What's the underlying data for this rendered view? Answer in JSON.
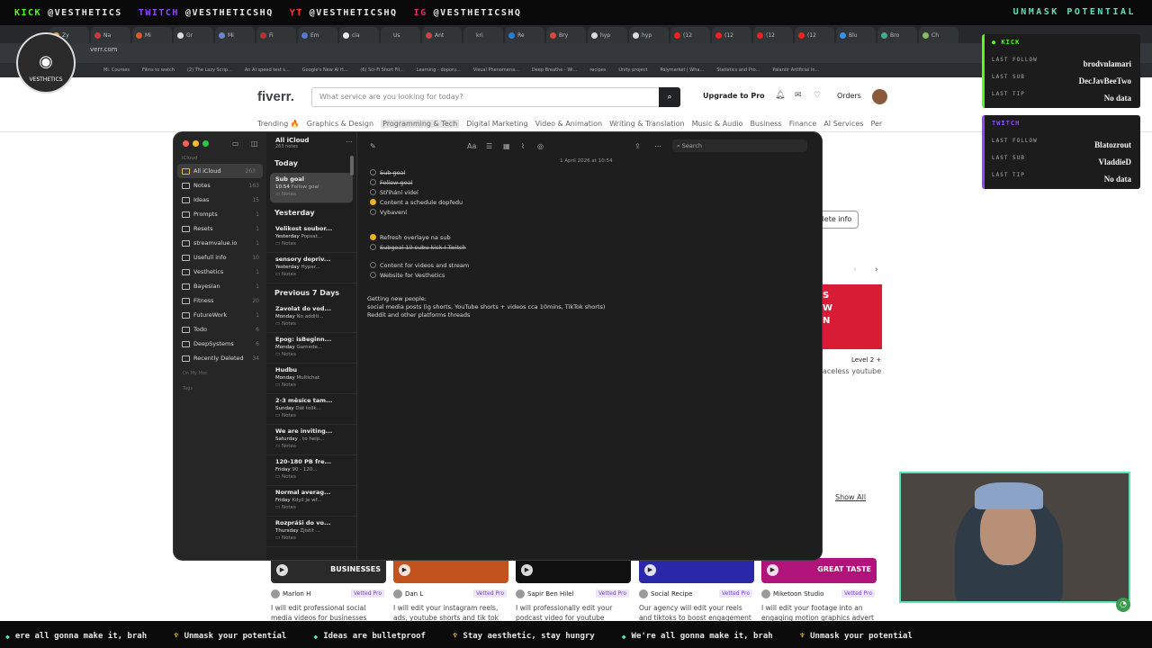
{
  "overlay_top": {
    "socials": [
      {
        "platform": "KICK",
        "handle": "@VESTHETICS",
        "color": "#53fc18"
      },
      {
        "platform": "TWITCH",
        "handle": "@VESTHETICSHQ",
        "color": "#9146ff"
      },
      {
        "platform": "YT",
        "handle": "@VESTHETICSHQ",
        "color": "#ff3b3b"
      },
      {
        "platform": "IG",
        "handle": "@VESTHETICSHQ",
        "color": "#e1306c"
      }
    ],
    "slogan": "UNMASK POTENTIAL"
  },
  "browser": {
    "tabs": [
      "Zy",
      "Na",
      "Mi",
      "Gr",
      "Mi",
      "Fi",
      "Em",
      "cla",
      "Us",
      "Ant",
      "kri",
      "Re",
      "Bry",
      "hyp",
      "hyp",
      "(12",
      "(12",
      "(12",
      "(12",
      "Blu",
      "Bro",
      "Ch"
    ],
    "url": "verr.com",
    "bookmarks": [
      "Mi. Courses",
      "Films to watch",
      "(2) The Lazy Scrip...",
      "An AI speed test s...",
      "Google's New AI H...",
      "(6) Sci-Fi Short Fil...",
      "Learning - doporu...",
      "Visual Phenomena...",
      "Deep Breathe - Wi...",
      "recipes",
      "Unity project",
      "Polymarket | Wha...",
      "Statistics and Pro...",
      "Palantir Artificial In..."
    ]
  },
  "fiverr": {
    "logo": "fiverr.",
    "search_placeholder": "What service are you looking for today?",
    "upgrade": "Upgrade to Pro",
    "orders": "Orders",
    "categories": [
      "Trending 🔥",
      "Graphics & Design",
      "Programming & Tech",
      "Digital Marketing",
      "Video & Animation",
      "Writing & Translation",
      "Music & Audio",
      "Business",
      "Finance",
      "AI Services",
      "Per"
    ],
    "delete_info": "elete info",
    "promo_text": "S\nW\nN",
    "level": "Level 2 +",
    "faceless": "aceless youtube",
    "show_all": "Show All",
    "gigs": [
      {
        "seller": "Marlon H",
        "badge": "Vetted Pro",
        "desc": "I will edit professional social media videos for businesses",
        "thumb": "#2a2a2a",
        "thumb_text": "BUSINESSES"
      },
      {
        "seller": "Dan L",
        "badge": "Vetted Pro",
        "desc": "I will edit your instagram reels, ads, youtube shorts and tik tok",
        "thumb": "#c2521e",
        "thumb_text": ""
      },
      {
        "seller": "Sapir Ben Hilel",
        "badge": "Vetted Pro",
        "desc": "I will professionally edit your podcast video for youtube",
        "thumb": "#111111",
        "thumb_text": ""
      },
      {
        "seller": "Social Recipe",
        "badge": "Vetted Pro",
        "desc": "Our agency will edit your reels and tiktoks to boost engagement",
        "thumb": "#2a27a8",
        "thumb_text": ""
      },
      {
        "seller": "Miketoon Studio",
        "badge": "Vetted Pro",
        "desc": "I will edit your footage into an engaging motion graphics advert",
        "thumb": "#b0147a",
        "thumb_text": "GREAT TASTE"
      }
    ]
  },
  "notes_app": {
    "header_title": "All iCloud",
    "header_count": "263 notes",
    "search_placeholder": "Search",
    "sidebar_section": "iCloud",
    "folders": [
      {
        "name": "All iCloud",
        "count": "263"
      },
      {
        "name": "Notes",
        "count": "163"
      },
      {
        "name": "Ideas",
        "count": "15"
      },
      {
        "name": "Prompts",
        "count": "1"
      },
      {
        "name": "Resets",
        "count": "1"
      },
      {
        "name": "streamvalue.io",
        "count": "1"
      },
      {
        "name": "Usefull info",
        "count": "10"
      },
      {
        "name": "Vesthetics",
        "count": "1"
      },
      {
        "name": "Bayesian",
        "count": "1"
      },
      {
        "name": "Fitness",
        "count": "20"
      },
      {
        "name": "FutureWork",
        "count": "1"
      },
      {
        "name": "Todo",
        "count": "6"
      },
      {
        "name": "DeepSystems",
        "count": "6"
      },
      {
        "name": "Recently Deleted",
        "count": "34"
      }
    ],
    "sidebar_footer": [
      "On My Mac",
      "Tags"
    ],
    "sections": {
      "today": "Today",
      "yesterday": "Yesterday",
      "prev7": "Previous 7 Days"
    },
    "notes": [
      {
        "section": "today",
        "title": "Sub goal",
        "time": "10:54",
        "snippet": "Follow goal",
        "folder": "Notes"
      },
      {
        "section": "yesterday",
        "title": "Velikost soubor...",
        "time": "Yesterday",
        "snippet": "Popsat...",
        "folder": "Notes"
      },
      {
        "section": "yesterday",
        "title": "sensory depriv...",
        "time": "Yesterday",
        "snippet": "Hyper...",
        "folder": "Notes"
      },
      {
        "section": "prev7",
        "title": "Zavolat do vod...",
        "time": "Monday",
        "snippet": "No additi...",
        "folder": "Notes"
      },
      {
        "section": "prev7",
        "title": "Epog: isBeginn...",
        "time": "Monday",
        "snippet": "Gamede...",
        "folder": "Notes"
      },
      {
        "section": "prev7",
        "title": "Hudbu",
        "time": "Monday",
        "snippet": "Multichat",
        "folder": "Notes"
      },
      {
        "section": "prev7",
        "title": "2-3 měsíce tam...",
        "time": "Sunday",
        "snippet": "Dát tolik...",
        "folder": "Notes"
      },
      {
        "section": "prev7",
        "title": "We are inviting...",
        "time": "Saturday",
        "snippet": ", to help...",
        "folder": "Notes"
      },
      {
        "section": "prev7",
        "title": "120-180 PB fre...",
        "time": "Friday",
        "snippet": "90 - 120...",
        "folder": "Notes"
      },
      {
        "section": "prev7",
        "title": "Normal averag...",
        "time": "Friday",
        "snippet": "Když je wf...",
        "folder": "Notes"
      },
      {
        "section": "prev7",
        "title": "Rozpráši do vo...",
        "time": "Thursday",
        "snippet": "Zjistit ...",
        "folder": "Notes"
      }
    ],
    "editor": {
      "date": "1 April 2026 at 10:54",
      "checklist_1": [
        {
          "text": "Sub goal",
          "done": false,
          "strike": true
        },
        {
          "text": "Follow goal",
          "done": false,
          "strike": true
        },
        {
          "text": "Střihání videí",
          "done": false,
          "strike": false
        },
        {
          "text": "Content a schedule dopředu",
          "done": true,
          "strike": false
        },
        {
          "text": "Vybavení",
          "done": false,
          "strike": false
        }
      ],
      "checklist_2": [
        {
          "text": "Refresh overlaye na sub",
          "done": true,
          "strike": false
        },
        {
          "text": "Subgoal 10 subu kick I Twitch",
          "done": false,
          "strike": true
        }
      ],
      "checklist_3": [
        {
          "text": "Content for videos and stream",
          "done": false,
          "strike": false
        },
        {
          "text": "Website for Vesthetics",
          "done": false,
          "strike": false
        }
      ],
      "body": [
        "Getting new people:",
        "social media posts (ig shorts, YouTube shorts + videos cca 10mins, TikTok shorts)",
        "Reddit and other platforms threads"
      ]
    }
  },
  "stream_panels": {
    "kick": {
      "title": "KICK",
      "follow_label": "LAST FOLLOW",
      "follow_value": "brodvnlamari",
      "sub_label": "LAST SUB",
      "sub_value": "DecJavBeeTwo",
      "tip_label": "LAST TIP",
      "tip_value": "No data"
    },
    "twitch": {
      "title": "TWITCH",
      "follow_label": "LAST FOLLOW",
      "follow_value": "Blatozrout",
      "sub_label": "LAST SUB",
      "sub_value": "VladdieD",
      "tip_label": "LAST TIP",
      "tip_value": "No data"
    }
  },
  "avatar_logo_text": "VESTHETICS",
  "ticker": [
    {
      "icon": "gd",
      "text": "ere all gonna make it, brah"
    },
    {
      "icon": "dm",
      "text": "Unmask your potential"
    },
    {
      "icon": "gd",
      "text": "Ideas are bulletproof"
    },
    {
      "icon": "dm",
      "text": "Stay aesthetic, stay hungry"
    },
    {
      "icon": "gd",
      "text": "We're all gonna make it, brah"
    },
    {
      "icon": "dm",
      "text": "Unmask your potential"
    }
  ]
}
